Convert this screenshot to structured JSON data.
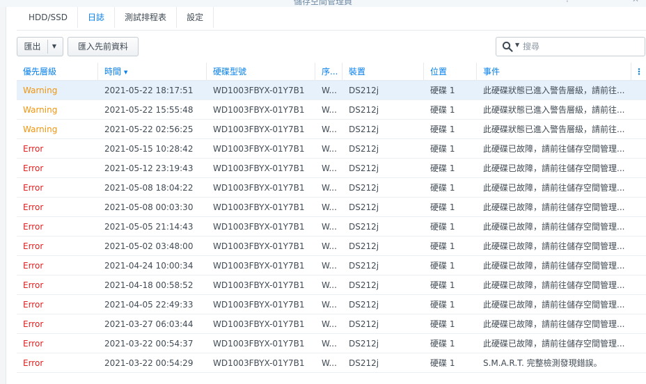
{
  "window": {
    "title": "儲存空間管理員"
  },
  "tabs": [
    "HDD/SSD",
    "日誌",
    "測試排程表",
    "設定"
  ],
  "toolbar": {
    "export_label": "匯出",
    "import_label": "匯入先前資料"
  },
  "search": {
    "placeholder": "搜尋"
  },
  "columns": [
    "優先層級",
    "時間",
    "硬碟型號",
    "序...",
    "裝置",
    "位置",
    "事件"
  ],
  "rows": [
    {
      "level": "Warning",
      "time": "2021-05-22 18:17:51",
      "model": "WD1003FBYX-01Y7B1",
      "serial": "W...",
      "device": "DS212j",
      "location": "硬碟 1",
      "event": "此硬碟狀態已進入警告層級，請前往..."
    },
    {
      "level": "Warning",
      "time": "2021-05-22 15:55:48",
      "model": "WD1003FBYX-01Y7B1",
      "serial": "W...",
      "device": "DS212j",
      "location": "硬碟 1",
      "event": "此硬碟狀態已進入警告層級，請前往..."
    },
    {
      "level": "Warning",
      "time": "2021-05-22 02:56:25",
      "model": "WD1003FBYX-01Y7B1",
      "serial": "W...",
      "device": "DS212j",
      "location": "硬碟 1",
      "event": "此硬碟狀態已進入警告層級，請前往..."
    },
    {
      "level": "Error",
      "time": "2021-05-15 10:28:42",
      "model": "WD1003FBYX-01Y7B1",
      "serial": "W...",
      "device": "DS212j",
      "location": "硬碟 1",
      "event": "此硬碟已故障，請前往儲存空間管理..."
    },
    {
      "level": "Error",
      "time": "2021-05-12 23:19:43",
      "model": "WD1003FBYX-01Y7B1",
      "serial": "W...",
      "device": "DS212j",
      "location": "硬碟 1",
      "event": "此硬碟已故障，請前往儲存空間管理..."
    },
    {
      "level": "Error",
      "time": "2021-05-08 18:04:22",
      "model": "WD1003FBYX-01Y7B1",
      "serial": "W...",
      "device": "DS212j",
      "location": "硬碟 1",
      "event": "此硬碟已故障，請前往儲存空間管理..."
    },
    {
      "level": "Error",
      "time": "2021-05-08 00:03:30",
      "model": "WD1003FBYX-01Y7B1",
      "serial": "W...",
      "device": "DS212j",
      "location": "硬碟 1",
      "event": "此硬碟已故障，請前往儲存空間管理..."
    },
    {
      "level": "Error",
      "time": "2021-05-05 21:14:43",
      "model": "WD1003FBYX-01Y7B1",
      "serial": "W...",
      "device": "DS212j",
      "location": "硬碟 1",
      "event": "此硬碟已故障，請前往儲存空間管理..."
    },
    {
      "level": "Error",
      "time": "2021-05-02 03:48:00",
      "model": "WD1003FBYX-01Y7B1",
      "serial": "W...",
      "device": "DS212j",
      "location": "硬碟 1",
      "event": "此硬碟已故障，請前往儲存空間管理..."
    },
    {
      "level": "Error",
      "time": "2021-04-24 10:00:34",
      "model": "WD1003FBYX-01Y7B1",
      "serial": "W...",
      "device": "DS212j",
      "location": "硬碟 1",
      "event": "此硬碟已故障，請前往儲存空間管理..."
    },
    {
      "level": "Error",
      "time": "2021-04-18 00:58:52",
      "model": "WD1003FBYX-01Y7B1",
      "serial": "W...",
      "device": "DS212j",
      "location": "硬碟 1",
      "event": "此硬碟已故障，請前往儲存空間管理..."
    },
    {
      "level": "Error",
      "time": "2021-04-05 22:49:33",
      "model": "WD1003FBYX-01Y7B1",
      "serial": "W...",
      "device": "DS212j",
      "location": "硬碟 1",
      "event": "此硬碟已故障，請前往儲存空間管理..."
    },
    {
      "level": "Error",
      "time": "2021-03-27 06:03:44",
      "model": "WD1003FBYX-01Y7B1",
      "serial": "W...",
      "device": "DS212j",
      "location": "硬碟 1",
      "event": "此硬碟已故障，請前往儲存空間管理..."
    },
    {
      "level": "Error",
      "time": "2021-03-22 00:54:37",
      "model": "WD1003FBYX-01Y7B1",
      "serial": "W...",
      "device": "DS212j",
      "location": "硬碟 1",
      "event": "此硬碟已故障，請前往儲存空間管理..."
    },
    {
      "level": "Error",
      "time": "2021-03-22 00:54:29",
      "model": "WD1003FBYX-01Y7B1",
      "serial": "W...",
      "device": "DS212j",
      "location": "硬碟 1",
      "event": "S.M.A.R.T. 完整檢測發現錯誤。"
    }
  ],
  "colors": {
    "accent": "#057feb",
    "warning": "#f0950d",
    "error": "#e01e1e",
    "selected_row": "#e6f1fc"
  },
  "icons": {
    "search": "search-icon",
    "export_dropdown": "chevron-down-icon",
    "column_menu": "column-menu-icon",
    "sort": "sort-desc-icon"
  }
}
